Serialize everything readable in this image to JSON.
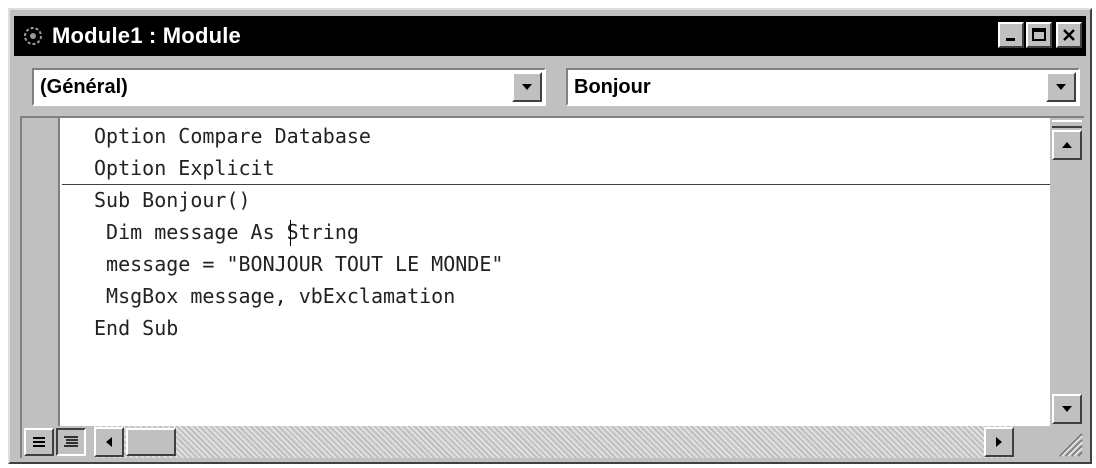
{
  "window": {
    "title": "Module1 : Module"
  },
  "selectors": {
    "object_value": "(Général)",
    "procedure_value": "Bonjour"
  },
  "code": {
    "declarations": [
      "Option Compare Database",
      "Option Explicit"
    ],
    "procedure": [
      "Sub Bonjour()",
      " Dim message As String",
      " message = \"BONJOUR TOUT LE MONDE\"",
      " MsgBox message, vbExclamation",
      "End Sub"
    ]
  },
  "icons": {
    "window_icon": "module-icon",
    "minimize": "minimize-icon",
    "maximize": "maximize-icon",
    "close": "close-icon"
  }
}
